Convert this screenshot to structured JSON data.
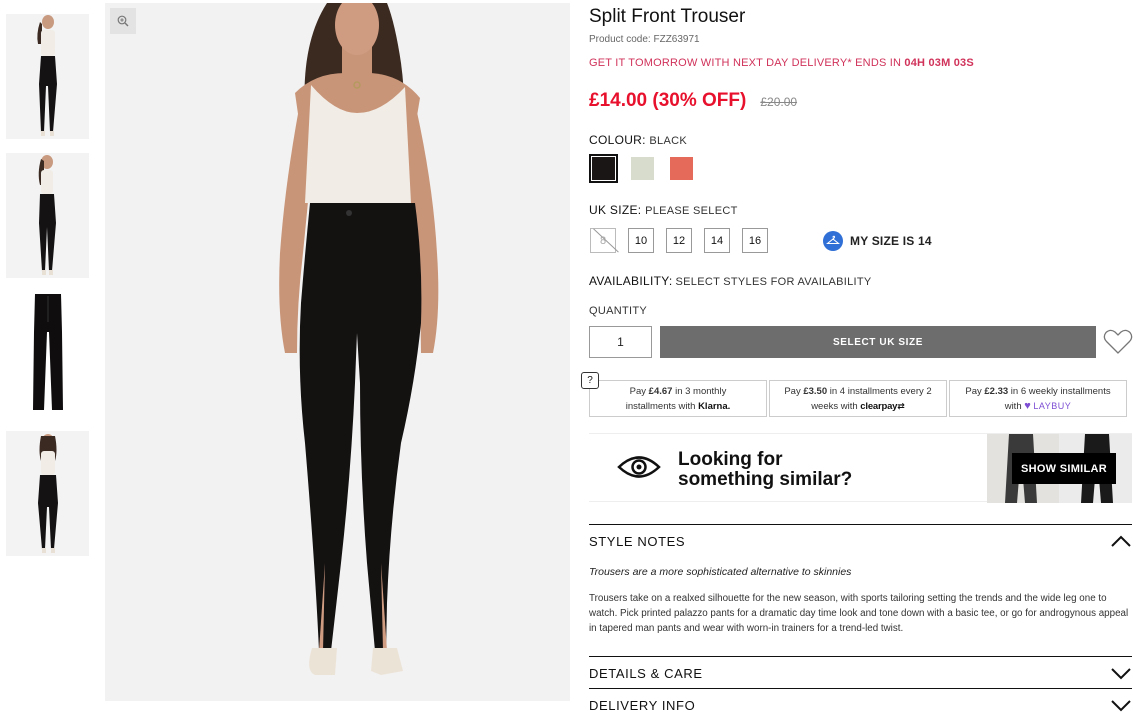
{
  "product": {
    "title": "Split Front Trouser",
    "product_code": "Product code: FZZ63971",
    "delivery_prefix": "GET IT TOMORROW WITH NEXT DAY DELIVERY* ENDS IN ",
    "delivery_countdown": "04H 03M 03S",
    "price": "£14.00 (30% OFF)",
    "old_price": "£20.00"
  },
  "colour": {
    "label": "COLOUR:",
    "value": "BLACK",
    "swatches": [
      {
        "name": "black",
        "color": "#1b1616",
        "selected": true
      },
      {
        "name": "sage",
        "color": "#d8dccd",
        "selected": false
      },
      {
        "name": "coral",
        "color": "#e56a5a",
        "selected": false
      }
    ]
  },
  "size": {
    "label": "UK SIZE:",
    "value": "PLEASE SELECT",
    "options": [
      "8",
      "10",
      "12",
      "14",
      "16"
    ],
    "my_size": "MY SIZE IS 14"
  },
  "availability": {
    "label": "AVAILABILITY:",
    "value": "SELECT STYLES FOR AVAILABILITY"
  },
  "quantity": {
    "label": "QUANTITY",
    "value": "1"
  },
  "add_button": "SELECT UK SIZE",
  "payments": {
    "help": "?",
    "klarna": {
      "line1_a": "Pay ",
      "amount": "£4.67",
      "line1_b": " in 3 monthly",
      "line2": "installments with ",
      "brand": "Klarna."
    },
    "clearpay": {
      "line1_a": "Pay ",
      "amount": "£3.50",
      "line1_b": " in 4 installments every 2",
      "line2": "weeks with ",
      "brand": "clearpay"
    },
    "laybuy": {
      "line1_a": "Pay ",
      "amount": "£2.33",
      "line1_b": " in 6 weekly installments",
      "line2": "with ",
      "brand": "LAYBUY"
    }
  },
  "similar": {
    "line1": "Looking for",
    "line2": "something similar?",
    "button": "SHOW SIMILAR"
  },
  "style_notes": {
    "title": "STYLE NOTES",
    "lead": "Trousers are a more sophisticated alternative to skinnies",
    "body": "Trousers take on a realxed silhouette for the new season, with sports tailoring setting the trends and the wide leg one to watch. Pick printed palazzo pants for a dramatic day time look and tone down with a basic tee, or go for androgynous appeal in tapered man pants and wear with worn-in trainers for a trend-led twist."
  },
  "details": {
    "title": "DETAILS & CARE"
  },
  "delivery_info": {
    "title": "DELIVERY INFO"
  }
}
